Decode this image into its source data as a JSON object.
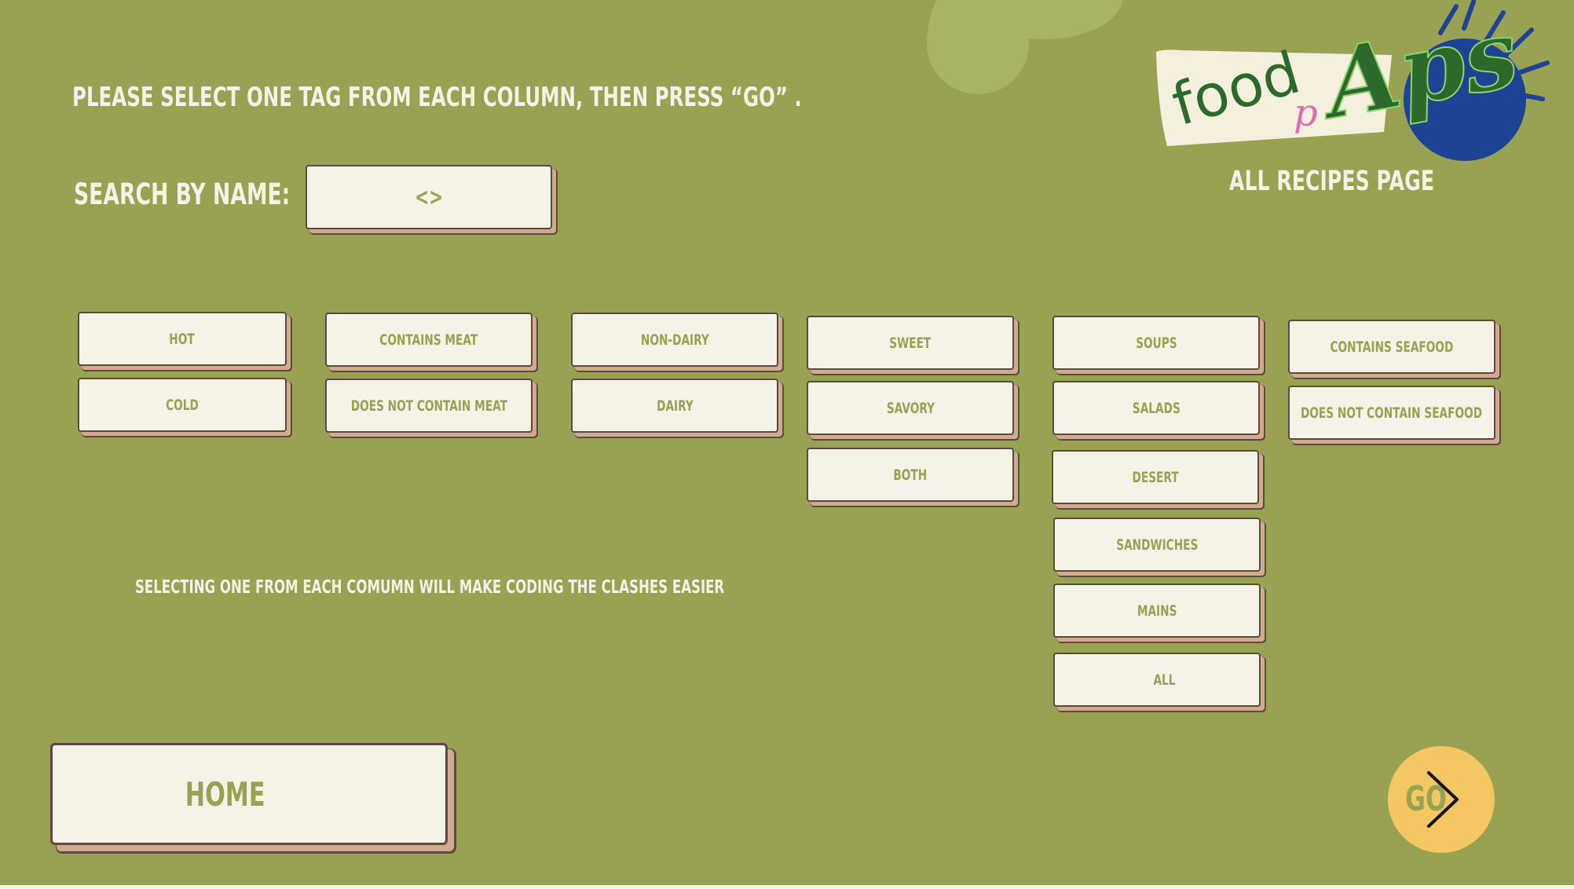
{
  "instruction": "PLEASE SELECT ONE TAG FROM EACH COLUMN, THEN PRESS “GO” .",
  "search": {
    "label": "SEARCH BY NAME:",
    "value": "<>"
  },
  "page_label": "ALL RECIPES PAGE",
  "logo": {
    "text_food": "food",
    "text_p": "p",
    "text_apps": "Aps"
  },
  "columns": [
    {
      "tags": [
        "HOT",
        "COLD"
      ]
    },
    {
      "tags": [
        "CONTAINS MEAT",
        "DOES NOT CONTAIN MEAT"
      ]
    },
    {
      "tags": [
        "NON-DAIRY",
        "DAIRY"
      ]
    },
    {
      "tags": [
        "SWEET",
        "SAVORY",
        "BOTH"
      ]
    },
    {
      "tags": [
        "SOUPS",
        "SALADS",
        "DESERT",
        "SANDWICHES",
        "MAINS",
        "ALL"
      ]
    },
    {
      "tags": [
        "CONTAINS SEAFOOD",
        "DOES NOT CONTAIN SEAFOOD"
      ]
    }
  ],
  "note": "SELECTING ONE FROM EACH COMUMN WILL MAKE CODING THE CLASHES EASIER",
  "home_label": "HOME",
  "go_label": "GO",
  "colors": {
    "background": "#99a152",
    "card": "#f5f2e7",
    "card_text": "#99a152",
    "card_shadow": "#d1aa90",
    "card_border": "#5d4a3e",
    "go_button": "#f4c762",
    "logo_globe": "#1d4494",
    "logo_text": "#2b6a2a"
  }
}
